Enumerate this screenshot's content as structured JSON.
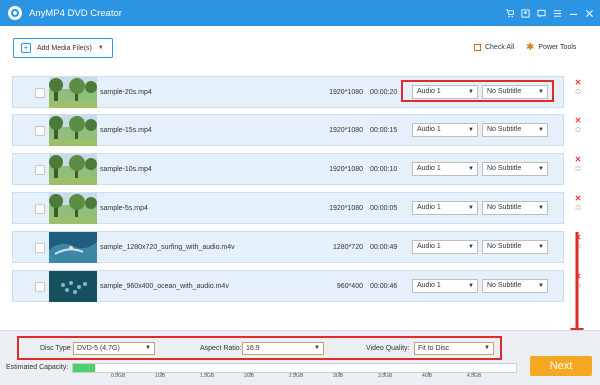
{
  "app": {
    "title": "AnyMP4 DVD Creator"
  },
  "toolbar": {
    "add_media_label": "Add Media File(s)",
    "check_all_label": "Check All",
    "power_tools_label": "Power Tools"
  },
  "colors": {
    "accent": "#2b95e3",
    "row_bg": "#e5f0fa",
    "next": "#f5a623",
    "highlight": "#e02b2b",
    "capacity_fill": "#4ed070"
  },
  "files": [
    {
      "name": "sample-20s.mp4",
      "resolution": "1920*1080",
      "duration": "00:00:20",
      "audio": "Audio 1",
      "subtitle": "No Subtitle",
      "thumb": "park"
    },
    {
      "name": "sample-15s.mp4",
      "resolution": "1920*1080",
      "duration": "00:00:15",
      "audio": "Audio 1",
      "subtitle": "No Subtitle",
      "thumb": "park"
    },
    {
      "name": "sample-10s.mp4",
      "resolution": "1920*1080",
      "duration": "00:00:10",
      "audio": "Audio 1",
      "subtitle": "No Subtitle",
      "thumb": "park"
    },
    {
      "name": "sample-5s.mp4",
      "resolution": "1920*1080",
      "duration": "00:00:05",
      "audio": "Audio 1",
      "subtitle": "No Subtitle",
      "thumb": "park"
    },
    {
      "name": "sample_1280x720_surfing_with_audio.m4v",
      "resolution": "1280*720",
      "duration": "00:00:49",
      "audio": "Audio 1",
      "subtitle": "No Subtitle",
      "thumb": "surf"
    },
    {
      "name": "sample_960x400_ocean_with_audio.m4v",
      "resolution": "960*400",
      "duration": "00:00:46",
      "audio": "Audio 1",
      "subtitle": "No Subtitle",
      "thumb": "ocean"
    }
  ],
  "settings": {
    "disc_type_label": "Disc Type",
    "disc_type_value": "DVD-5 (4.7G)",
    "aspect_ratio_label": "Aspect Ratio:",
    "aspect_ratio_value": "16:9",
    "video_quality_label": "Video Quality:",
    "video_quality_value": "Fit to Disc"
  },
  "capacity": {
    "label": "Estimated Capacity:",
    "fill_fraction": 0.05,
    "ticks": [
      "0.5GB",
      "1GB",
      "1.5GB",
      "2GB",
      "2.5GB",
      "3GB",
      "3.5GB",
      "4GB",
      "4.5GB"
    ]
  },
  "actions": {
    "next_label": "Next"
  }
}
